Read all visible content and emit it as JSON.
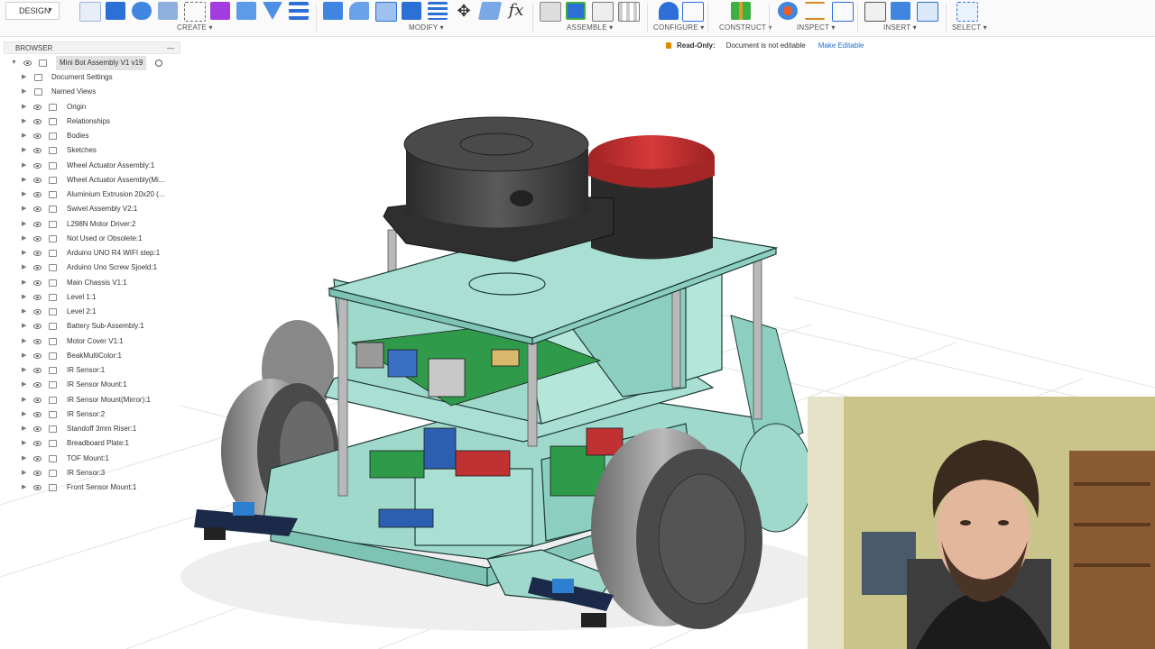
{
  "workspace": {
    "label": "DESIGN"
  },
  "toolbar": {
    "groups": [
      {
        "label": "CREATE"
      },
      {
        "label": "MODIFY"
      },
      {
        "label": "ASSEMBLE"
      },
      {
        "label": "CONFIGURE"
      },
      {
        "label": "CONSTRUCT"
      },
      {
        "label": "INSPECT"
      },
      {
        "label": "INSERT"
      },
      {
        "label": "SELECT"
      }
    ]
  },
  "browser": {
    "title": "BROWSER",
    "root": "Mini Bot Assembly V1 v19",
    "items": [
      {
        "label": "Document Settings",
        "icon": "gear-icon"
      },
      {
        "label": "Named Views",
        "icon": "folder-icon"
      },
      {
        "label": "Origin",
        "icon": "folder-icon"
      },
      {
        "label": "Relationships",
        "icon": "folder-icon"
      },
      {
        "label": "Bodies",
        "icon": "folder-icon"
      },
      {
        "label": "Sketches",
        "icon": "folder-icon"
      },
      {
        "label": "Wheel Actuator Assembly:1",
        "icon": "component-icon"
      },
      {
        "label": "Wheel Actuator Assembly(Mi...",
        "icon": "component-icon"
      },
      {
        "label": "Aluminium Extrusion 20x20 (...",
        "icon": "component-icon"
      },
      {
        "label": "Swivel Assembly V2:1",
        "icon": "component-icon"
      },
      {
        "label": "L298N Motor Driver:2",
        "icon": "component-icon"
      },
      {
        "label": "Not Used or Obsolete:1",
        "icon": "component-icon"
      },
      {
        "label": "Arduino UNO R4 WIFI step:1",
        "icon": "component-icon"
      },
      {
        "label": "Arduino Uno Screw Sjoeld:1",
        "icon": "component-icon"
      },
      {
        "label": "Main Chassis V1:1",
        "icon": "component-icon"
      },
      {
        "label": "Level 1:1",
        "icon": "component-icon"
      },
      {
        "label": "Level 2:1",
        "icon": "component-icon"
      },
      {
        "label": "Battery Sub-Assembly:1",
        "icon": "component-icon"
      },
      {
        "label": "Motor Cover V1:1",
        "icon": "component-icon"
      },
      {
        "label": "BeakMultiColor:1",
        "icon": "component-icon"
      },
      {
        "label": "IR Sensor:1",
        "icon": "component-icon"
      },
      {
        "label": "IR Sensor Mount:1",
        "icon": "component-icon"
      },
      {
        "label": "IR Sensor Mount(Mirror):1",
        "icon": "component-icon"
      },
      {
        "label": "IR Sensor:2",
        "icon": "component-icon"
      },
      {
        "label": "Standoff 3mm Riser:1",
        "icon": "component-icon"
      },
      {
        "label": "Breadboard Plate:1",
        "icon": "component-icon"
      },
      {
        "label": "TOF Mount:1",
        "icon": "component-icon"
      },
      {
        "label": "IR Sensor:3",
        "icon": "component-icon"
      },
      {
        "label": "Front Sensor Mount:1",
        "icon": "component-icon"
      }
    ]
  },
  "status": {
    "read_only": "Read-Only:",
    "message": "Document is not editable",
    "make_editable": "Make Editable"
  },
  "colors": {
    "chassis": "#9fd9cc",
    "lidar": "#3a3a3a",
    "button_red": "#c62f2f",
    "pcb_green": "#2f9b4a",
    "accent_blue": "#1f6fd1"
  }
}
